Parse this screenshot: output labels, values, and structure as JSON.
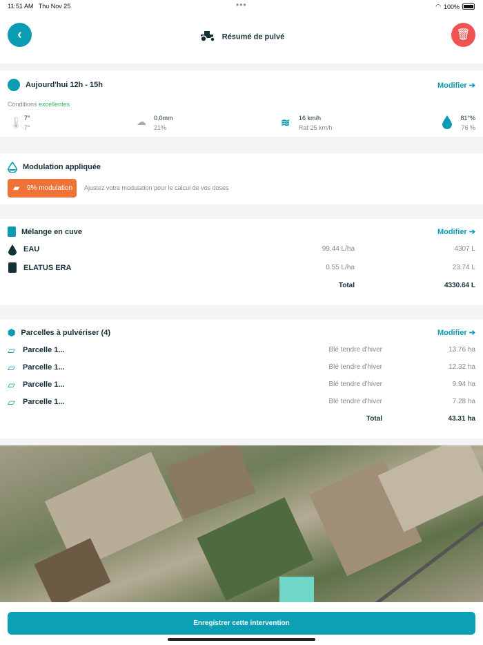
{
  "status": {
    "time": "11:51 AM",
    "date": "Thu Nov 25",
    "battery": "100%",
    "battery_level": 100
  },
  "header": {
    "title": "Résumé de pulvé",
    "back_icon": "chevron-left-icon",
    "tractor_icon": "tractor-icon",
    "delete_icon": "trash-icon"
  },
  "weather": {
    "title": "Aujourd'hui 12h - 15h",
    "modify": "Modifier",
    "conditions_label": "Conditions",
    "conditions_value": "excellentes",
    "conditions_color": "#2fb56a",
    "temp_max": "7°",
    "temp_min": "7°",
    "rain": "0.0mm",
    "rain_prob": "21%",
    "wind": "16 km/h",
    "gust": "Raf 25 km/h",
    "humidity": "81°%",
    "humidity2": "76 %"
  },
  "modulation": {
    "title": "Modulation appliquée",
    "badge": "9% modulation",
    "hint": "Ajustez votre modulation pour le calcul de vos doses",
    "badge_color": "#ef7236"
  },
  "mix": {
    "title": "Mélange en cuve",
    "modify": "Modifier",
    "rows": [
      {
        "name": "EAU",
        "rate": "99.44 L/ha",
        "qty": "4307 L"
      },
      {
        "name": "ELATUS ERA",
        "rate": "0.55 L/ha",
        "qty": "23.74 L"
      }
    ],
    "total_label": "Total",
    "total": "4330.64 L"
  },
  "parcels": {
    "title": "Parcelles à pulvériser (4)",
    "modify": "Modifier",
    "rows": [
      {
        "name": "Parcelle 1...",
        "crop": "Blé tendre d'hiver",
        "area": "13.76 ha"
      },
      {
        "name": "Parcelle 1...",
        "crop": "Blé tendre d'hiver",
        "area": "12.32 ha"
      },
      {
        "name": "Parcelle 1...",
        "crop": "Blé tendre d'hiver",
        "area": "9.94 ha"
      },
      {
        "name": "Parcelle 1...",
        "crop": "Blé tendre d'hiver",
        "area": "7.28 ha"
      }
    ],
    "total_label": "Total",
    "total": "43.31 ha"
  },
  "save_label": "Enregistrer cette intervention",
  "accent": "#0b9cb4"
}
